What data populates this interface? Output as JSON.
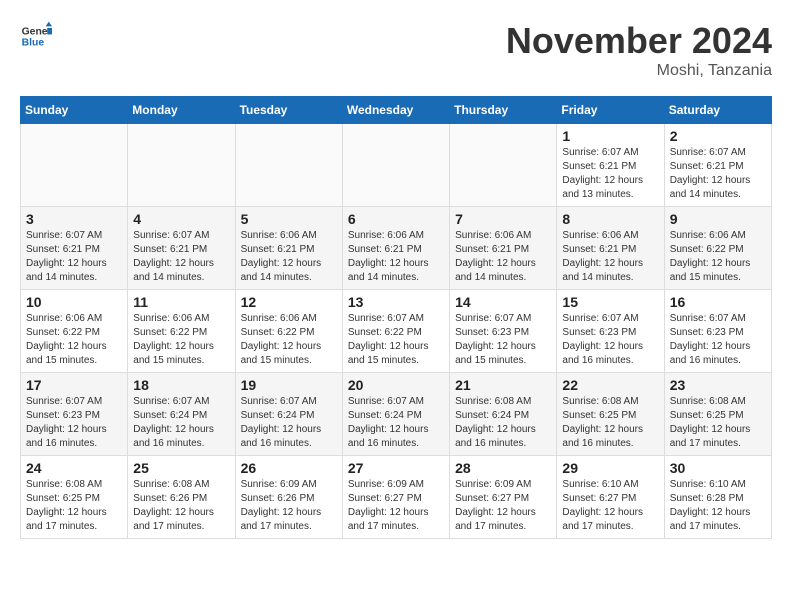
{
  "header": {
    "logo_line1": "General",
    "logo_line2": "Blue",
    "month": "November 2024",
    "location": "Moshi, Tanzania"
  },
  "weekdays": [
    "Sunday",
    "Monday",
    "Tuesday",
    "Wednesday",
    "Thursday",
    "Friday",
    "Saturday"
  ],
  "weeks": [
    [
      {
        "day": "",
        "info": ""
      },
      {
        "day": "",
        "info": ""
      },
      {
        "day": "",
        "info": ""
      },
      {
        "day": "",
        "info": ""
      },
      {
        "day": "",
        "info": ""
      },
      {
        "day": "1",
        "info": "Sunrise: 6:07 AM\nSunset: 6:21 PM\nDaylight: 12 hours\nand 13 minutes."
      },
      {
        "day": "2",
        "info": "Sunrise: 6:07 AM\nSunset: 6:21 PM\nDaylight: 12 hours\nand 14 minutes."
      }
    ],
    [
      {
        "day": "3",
        "info": "Sunrise: 6:07 AM\nSunset: 6:21 PM\nDaylight: 12 hours\nand 14 minutes."
      },
      {
        "day": "4",
        "info": "Sunrise: 6:07 AM\nSunset: 6:21 PM\nDaylight: 12 hours\nand 14 minutes."
      },
      {
        "day": "5",
        "info": "Sunrise: 6:06 AM\nSunset: 6:21 PM\nDaylight: 12 hours\nand 14 minutes."
      },
      {
        "day": "6",
        "info": "Sunrise: 6:06 AM\nSunset: 6:21 PM\nDaylight: 12 hours\nand 14 minutes."
      },
      {
        "day": "7",
        "info": "Sunrise: 6:06 AM\nSunset: 6:21 PM\nDaylight: 12 hours\nand 14 minutes."
      },
      {
        "day": "8",
        "info": "Sunrise: 6:06 AM\nSunset: 6:21 PM\nDaylight: 12 hours\nand 14 minutes."
      },
      {
        "day": "9",
        "info": "Sunrise: 6:06 AM\nSunset: 6:22 PM\nDaylight: 12 hours\nand 15 minutes."
      }
    ],
    [
      {
        "day": "10",
        "info": "Sunrise: 6:06 AM\nSunset: 6:22 PM\nDaylight: 12 hours\nand 15 minutes."
      },
      {
        "day": "11",
        "info": "Sunrise: 6:06 AM\nSunset: 6:22 PM\nDaylight: 12 hours\nand 15 minutes."
      },
      {
        "day": "12",
        "info": "Sunrise: 6:06 AM\nSunset: 6:22 PM\nDaylight: 12 hours\nand 15 minutes."
      },
      {
        "day": "13",
        "info": "Sunrise: 6:07 AM\nSunset: 6:22 PM\nDaylight: 12 hours\nand 15 minutes."
      },
      {
        "day": "14",
        "info": "Sunrise: 6:07 AM\nSunset: 6:23 PM\nDaylight: 12 hours\nand 15 minutes."
      },
      {
        "day": "15",
        "info": "Sunrise: 6:07 AM\nSunset: 6:23 PM\nDaylight: 12 hours\nand 16 minutes."
      },
      {
        "day": "16",
        "info": "Sunrise: 6:07 AM\nSunset: 6:23 PM\nDaylight: 12 hours\nand 16 minutes."
      }
    ],
    [
      {
        "day": "17",
        "info": "Sunrise: 6:07 AM\nSunset: 6:23 PM\nDaylight: 12 hours\nand 16 minutes."
      },
      {
        "day": "18",
        "info": "Sunrise: 6:07 AM\nSunset: 6:24 PM\nDaylight: 12 hours\nand 16 minutes."
      },
      {
        "day": "19",
        "info": "Sunrise: 6:07 AM\nSunset: 6:24 PM\nDaylight: 12 hours\nand 16 minutes."
      },
      {
        "day": "20",
        "info": "Sunrise: 6:07 AM\nSunset: 6:24 PM\nDaylight: 12 hours\nand 16 minutes."
      },
      {
        "day": "21",
        "info": "Sunrise: 6:08 AM\nSunset: 6:24 PM\nDaylight: 12 hours\nand 16 minutes."
      },
      {
        "day": "22",
        "info": "Sunrise: 6:08 AM\nSunset: 6:25 PM\nDaylight: 12 hours\nand 16 minutes."
      },
      {
        "day": "23",
        "info": "Sunrise: 6:08 AM\nSunset: 6:25 PM\nDaylight: 12 hours\nand 17 minutes."
      }
    ],
    [
      {
        "day": "24",
        "info": "Sunrise: 6:08 AM\nSunset: 6:25 PM\nDaylight: 12 hours\nand 17 minutes."
      },
      {
        "day": "25",
        "info": "Sunrise: 6:08 AM\nSunset: 6:26 PM\nDaylight: 12 hours\nand 17 minutes."
      },
      {
        "day": "26",
        "info": "Sunrise: 6:09 AM\nSunset: 6:26 PM\nDaylight: 12 hours\nand 17 minutes."
      },
      {
        "day": "27",
        "info": "Sunrise: 6:09 AM\nSunset: 6:27 PM\nDaylight: 12 hours\nand 17 minutes."
      },
      {
        "day": "28",
        "info": "Sunrise: 6:09 AM\nSunset: 6:27 PM\nDaylight: 12 hours\nand 17 minutes."
      },
      {
        "day": "29",
        "info": "Sunrise: 6:10 AM\nSunset: 6:27 PM\nDaylight: 12 hours\nand 17 minutes."
      },
      {
        "day": "30",
        "info": "Sunrise: 6:10 AM\nSunset: 6:28 PM\nDaylight: 12 hours\nand 17 minutes."
      }
    ]
  ]
}
